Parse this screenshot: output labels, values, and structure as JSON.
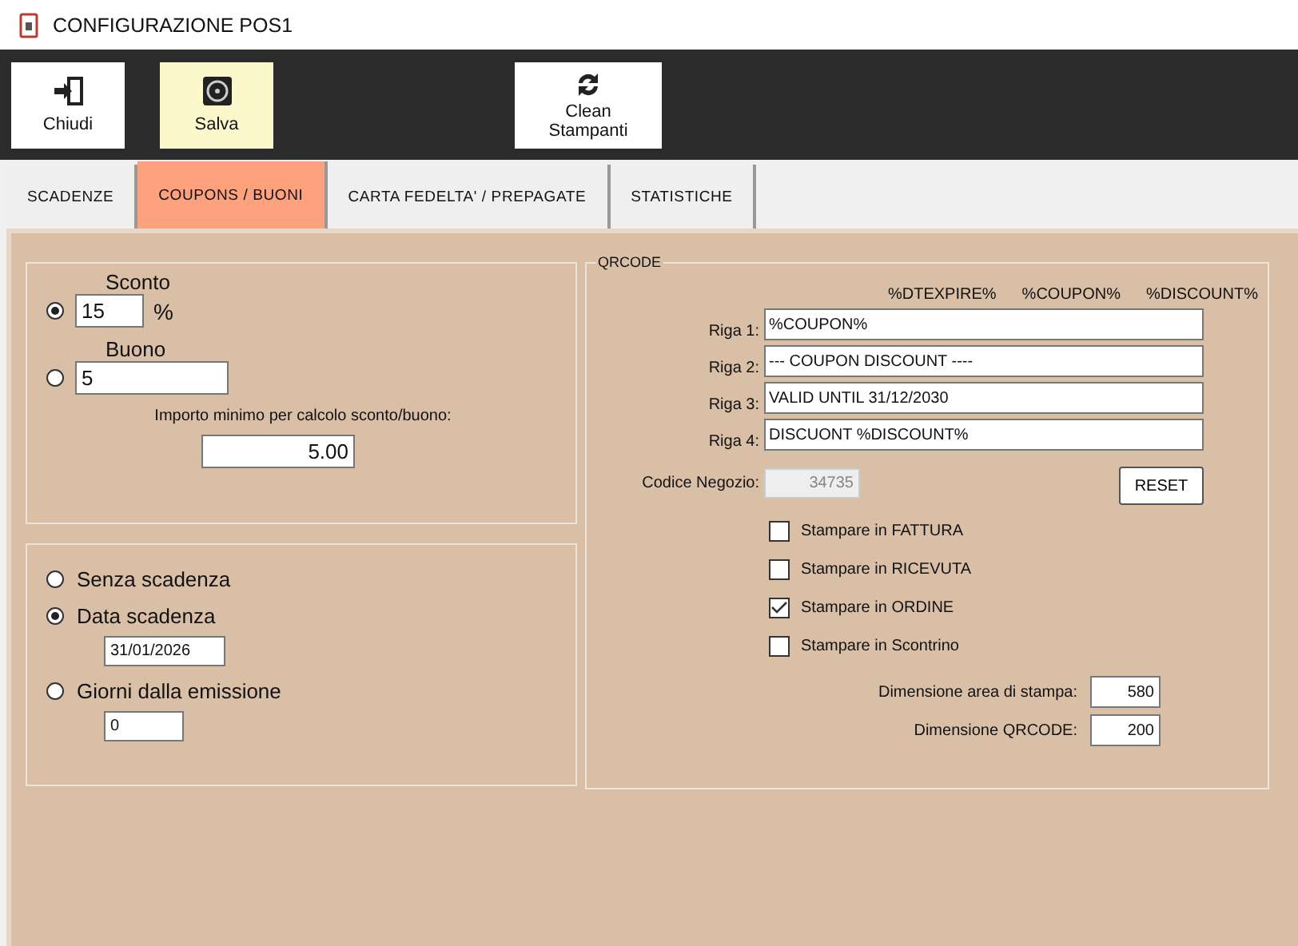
{
  "window": {
    "title": "CONFIGURAZIONE POS1"
  },
  "toolbar": {
    "buttons": [
      {
        "label": "Chiudi",
        "kind": "exit",
        "highlighted": false
      },
      {
        "label": "Salva",
        "kind": "disk",
        "highlighted": true
      },
      {
        "label": "Clean Stampanti",
        "kind": "refresh",
        "highlighted": false
      }
    ]
  },
  "tabs": [
    {
      "label": "SCADENZE",
      "selected": false
    },
    {
      "label": "COUPONS / BUONI",
      "selected": true
    },
    {
      "label": "CARTA FEDELTA' / PREPAGATE",
      "selected": false
    },
    {
      "label": "STATISTICHE",
      "selected": false
    }
  ],
  "discount": {
    "options": [
      {
        "label": "Sconto",
        "selected": true,
        "value": "15",
        "unit": "%"
      },
      {
        "label": "Buono",
        "selected": false,
        "value": "5"
      }
    ],
    "minimum_label": "Importo minimo per calcolo sconto/buono:",
    "minimum_value": "5.00"
  },
  "expiry": {
    "options": [
      {
        "label": "Senza scadenza",
        "selected": false
      },
      {
        "label": "Data scadenza",
        "selected": true,
        "value": "31/01/2026"
      },
      {
        "label": "Giorni dalla emissione",
        "selected": false,
        "value": "0"
      }
    ]
  },
  "qrcode": {
    "title": "QRCODE",
    "placeholders": [
      "%DTEXPIRE%",
      "%COUPON%",
      "%DISCOUNT%"
    ],
    "lines": [
      {
        "label": "Riga 1:",
        "value": "%COUPON%"
      },
      {
        "label": "Riga 2:",
        "value": "--- COUPON DISCOUNT ----"
      },
      {
        "label": "Riga 3:",
        "value": "VALID UNTIL 31/12/2030"
      },
      {
        "label": "Riga 4:",
        "value": "DISCUONT %DISCOUNT%"
      }
    ],
    "store_code": {
      "label": "Codice Negozio:",
      "value": "34735",
      "disabled": true
    },
    "reset_label": "RESET",
    "print_options": [
      {
        "label": "Stampare in FATTURA",
        "checked": false
      },
      {
        "label": "Stampare in RICEVUTA",
        "checked": false
      },
      {
        "label": "Stampare in ORDINE",
        "checked": true
      },
      {
        "label": "Stampare in Scontrino",
        "checked": false
      }
    ],
    "sizes": [
      {
        "label": "Dimensione area di stampa:",
        "value": "580"
      },
      {
        "label": "Dimensione QRCODE:",
        "value": "200"
      }
    ]
  }
}
